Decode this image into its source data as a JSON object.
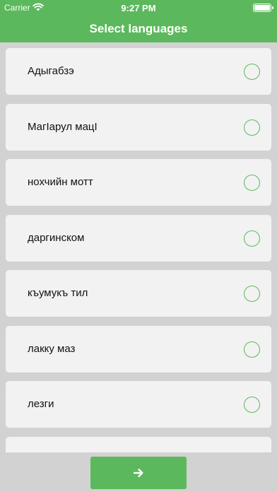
{
  "status_bar": {
    "carrier": "Carrier",
    "time": "9:27 PM",
    "wifi_icon": "wifi-icon",
    "battery_icon": "battery-icon"
  },
  "header": {
    "title": "Select languages",
    "background_color": "#5cb85c"
  },
  "languages": [
    {
      "label": "Адыгабзэ",
      "selected": false
    },
    {
      "label": "МагIарул мацI",
      "selected": false
    },
    {
      "label": "нохчийн мотт",
      "selected": false
    },
    {
      "label": "даргинском",
      "selected": false
    },
    {
      "label": "къумукъ тил",
      "selected": false
    },
    {
      "label": "лакку маз",
      "selected": false
    },
    {
      "label": "лезги",
      "selected": false
    },
    {
      "label": "",
      "selected": false
    }
  ],
  "next_button": {
    "icon": "arrow-right-icon"
  }
}
